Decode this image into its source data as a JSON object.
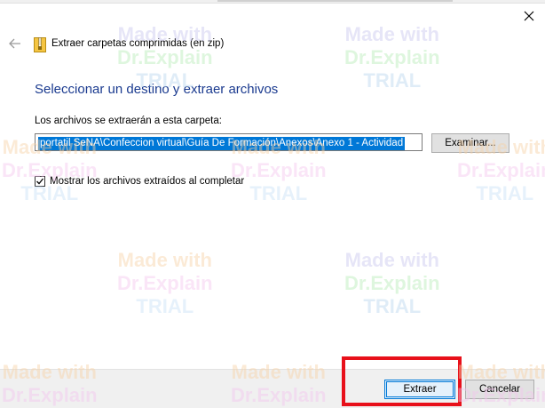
{
  "window": {
    "title": "Extraer carpetas comprimidas (en zip)",
    "close_icon": "close-icon",
    "back_icon": "back-arrow-icon",
    "folder_icon": "zip-folder-icon"
  },
  "main": {
    "heading": "Seleccionar un destino y extraer archivos",
    "path_label": "Los archivos se extraerán a esta carpeta:",
    "path_value": "portatil SeNA\\Confeccion virtual\\Guía De Formación\\Anexos\\Anexo 1 - Actividad",
    "browse_label": "Examinar...",
    "show_files_label": "Mostrar los archivos extraídos al completar",
    "show_files_checked": true
  },
  "footer": {
    "extract_label": "Extraer",
    "cancel_label": "Cancelar"
  },
  "watermark": {
    "line1": "Made with",
    "line2": "Dr.Explain",
    "line3": "TRIAL"
  },
  "colors": {
    "accent": "#0078d7",
    "heading": "#1a3a8f",
    "highlight": "#e8101a"
  }
}
